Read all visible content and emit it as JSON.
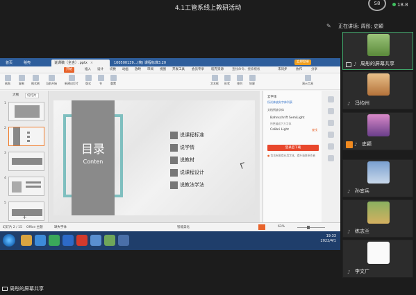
{
  "meeting": {
    "title": "4.1工管系线上教研活动",
    "cat_badge": "S8",
    "net_speed": "18.8",
    "speaking": "正在讲话: 周彤; 史颖"
  },
  "shared_screen": {
    "tabs": [
      {
        "label": "首页"
      },
      {
        "label": "稻壳"
      },
      {
        "label": "说课稿（全含）.pptx"
      },
      {
        "label": "100500139...(简) 课程标准3.20"
      }
    ],
    "login_btn": "立即登录",
    "menus": [
      "开始",
      "插入",
      "设计",
      "切换",
      "动画",
      "放映",
      "审阅",
      "视图",
      "开发工具",
      "会员专享",
      "稻壳资源"
    ],
    "menu_search": "查找命令、搜索模板",
    "menu_right": [
      "未同步",
      "协作",
      "分享"
    ],
    "toolbar": [
      "粘贴",
      "复制",
      "格式刷",
      "当前开始",
      "新建幻灯片",
      "版式",
      "节",
      "重置",
      "文本框",
      "形状",
      "排列",
      "轮廓",
      "演示工具"
    ],
    "left_tabs": [
      "大纲",
      "幻灯片"
    ],
    "thumb_labels": [
      "1",
      "2",
      "3",
      "4",
      "5"
    ],
    "slide": {
      "title": "目录",
      "subtitle": "Conten",
      "items": [
        "说课程标准",
        "说学情",
        "说教材",
        "说课程设计",
        "说教法学法"
      ]
    },
    "notes_placeholder": "单击此处添加备注",
    "right_panel": {
      "title": "云字体",
      "link": "所试体缺失字体列表",
      "heading": "文档所缺字体",
      "fonts": [
        {
          "name": "Bahnschrift SemiLight",
          "action": ""
        },
        {
          "name": "所更编成下方字体",
          "action": ""
        },
        {
          "name": "Calibri Light",
          "action": "查找"
        }
      ],
      "button": "登录后下载",
      "warning": "包含有限商业用字体，提升请联系作者"
    },
    "status": {
      "slide_info": "幻灯片 2 / 15",
      "theme": "Office 主题",
      "spell": "缺失字体",
      "beautify": "智能美化",
      "zoom": "63%"
    },
    "clock": {
      "time": "19:33",
      "date": "2022/4/1"
    }
  },
  "participants": [
    {
      "name": "周彤的屏幕共享",
      "selected": true,
      "kind": "share"
    },
    {
      "name": "冯均州",
      "selected": false,
      "kind": "mic"
    },
    {
      "name": "史颖",
      "selected": false,
      "kind": "active"
    },
    {
      "name": "孙宜兵",
      "selected": false,
      "kind": "mic"
    },
    {
      "name": "练志兰",
      "selected": false,
      "kind": "mic"
    },
    {
      "name": "李文广",
      "selected": false,
      "kind": "mic"
    }
  ],
  "bottom_share": "周彤的屏幕共享"
}
